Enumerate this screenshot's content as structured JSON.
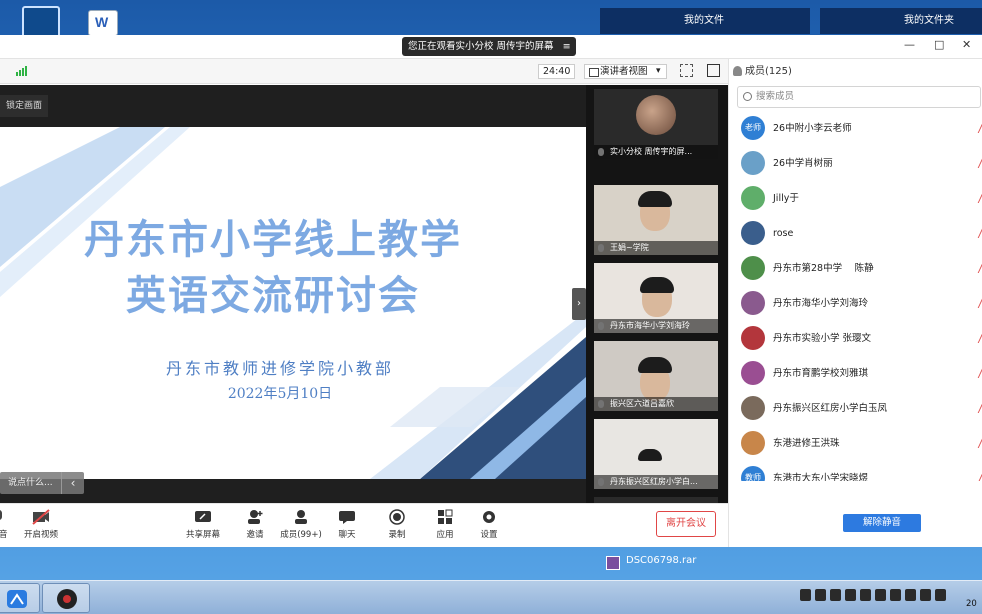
{
  "desktop": {
    "files_left": "我的文件",
    "files_right": "我的文件夹",
    "word_icon_letter": "W",
    "file_under_window": "DSC06798.rar"
  },
  "share_banner": {
    "text": "您正在观看实小分校 周传宇的屏幕",
    "menu_icon": "≡"
  },
  "window_controls": {
    "minimize": "—",
    "maximize": "□",
    "close": "✕"
  },
  "toolbar": {
    "timer": "24:40",
    "view_mode": "演讲者视图"
  },
  "stage": {
    "tip": "锁定画面",
    "comment_placeholder": "说点什么..."
  },
  "slide": {
    "title_line1": "丹东市小学线上教学",
    "title_line2": "英语交流研讨会",
    "organizer": "丹东市教师进修学院小教部",
    "date": "2022年5月10日"
  },
  "videos": [
    {
      "name": "实小分校 周传宇的屏..."
    },
    {
      "name": "王娟~学院"
    },
    {
      "name": "丹东市海华小学刘海玲"
    },
    {
      "name": "振兴区六道吕嘉欣"
    },
    {
      "name": "丹东振兴区红房小学白..."
    }
  ],
  "strip_collapse": "›",
  "bottom_toolbar": {
    "mute_label": "静音",
    "video_label": "开启视频",
    "share_label": "共享屏幕",
    "invite_label": "邀请",
    "members_label": "成员(99+)",
    "chat_label": "聊天",
    "record_label": "录制",
    "apps_label": "应用",
    "settings_label": "设置",
    "leave_label": "离开会议"
  },
  "members_panel": {
    "title": "成员(125)",
    "search_placeholder": "搜索成员",
    "unmute_all": "解除静音",
    "items": [
      {
        "name": "26中附小李云老师",
        "avatar_text": "老师",
        "color": "#2f7fd4"
      },
      {
        "name": "26中学肖树丽",
        "avatar_text": "",
        "color": "#6aa0c8"
      },
      {
        "name": "Jilly于",
        "avatar_text": "",
        "color": "#5fae6a"
      },
      {
        "name": "rose",
        "avatar_text": "",
        "color": "#3a5e8c"
      },
      {
        "name": "丹东市第28中学　 陈静",
        "avatar_text": "",
        "color": "#4e8f4a"
      },
      {
        "name": "丹东市海华小学刘海玲",
        "avatar_text": "",
        "color": "#8a5a8e"
      },
      {
        "name": "丹东市实验小学 张璎文",
        "avatar_text": "",
        "color": "#b3363c"
      },
      {
        "name": "丹东市育鹏学校刘雅琪",
        "avatar_text": "",
        "color": "#9a4e92"
      },
      {
        "name": "丹东振兴区红房小学白玉凤",
        "avatar_text": "",
        "color": "#7a6a5c"
      },
      {
        "name": "东港进修王洪珠",
        "avatar_text": "",
        "color": "#c8864a"
      },
      {
        "name": "东港市大东小学宋晓煜",
        "avatar_text": "教师",
        "color": "#2f7fd4"
      }
    ]
  },
  "taskbar": {
    "clock": "20"
  }
}
